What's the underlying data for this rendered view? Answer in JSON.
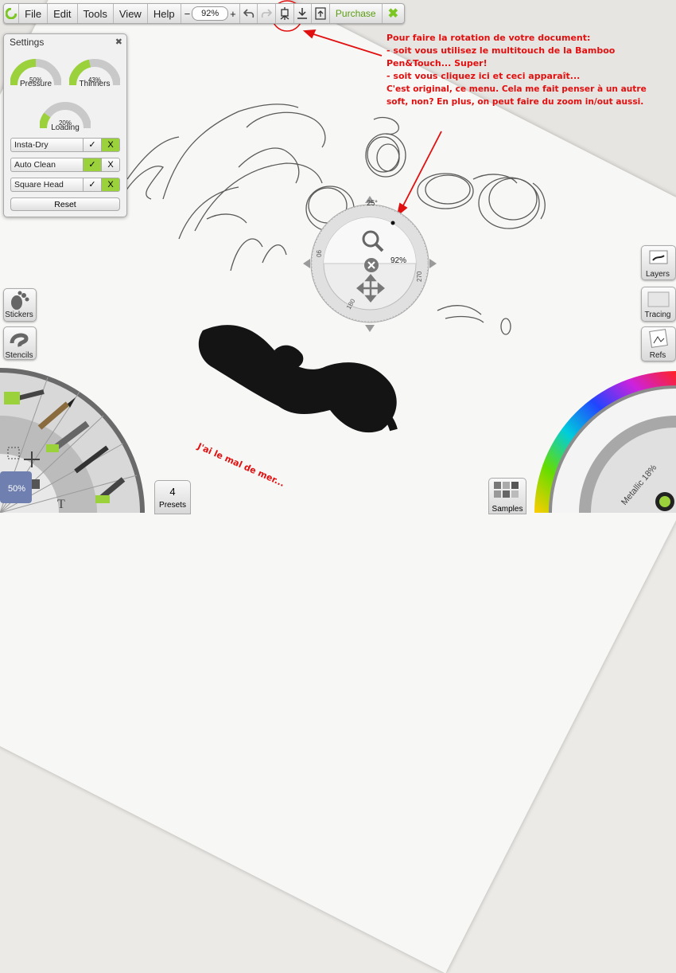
{
  "toolbar": {
    "menus": [
      "File",
      "Edit",
      "Tools",
      "View",
      "Help"
    ],
    "zoom_minus": "−",
    "zoom_value": "92%",
    "zoom_plus": "+",
    "purchase": "Purchase"
  },
  "settings": {
    "title": "Settings",
    "gauges": [
      {
        "label": "Pressure",
        "value": "50%",
        "level": 0.5
      },
      {
        "label": "Thinners",
        "value": "43%",
        "level": 0.43
      },
      {
        "label": "Loading",
        "value": "20%",
        "level": 0.2
      }
    ],
    "options": [
      {
        "label": "Insta-Dry",
        "check": "✓",
        "x": "X",
        "selected": "x"
      },
      {
        "label": "Auto Clean",
        "check": "✓",
        "x": "X",
        "selected": "check"
      },
      {
        "label": "Square Head",
        "check": "✓",
        "x": "X",
        "selected": "x"
      }
    ],
    "reset": "Reset"
  },
  "rotation_dial": {
    "angle_top": "25°",
    "zoom": "92%",
    "ticks": [
      "90",
      "270",
      "180"
    ]
  },
  "left_tools": {
    "stickers": "Stickers",
    "stencils": "Stencils",
    "brush_size": "50%"
  },
  "presets": {
    "count": "4",
    "label": "Presets"
  },
  "samples": {
    "label": "Samples"
  },
  "right_tools": {
    "layers": "Layers",
    "tracing": "Tracing",
    "refs": "Refs"
  },
  "color_wheel": {
    "metallic": "Metallic 18%"
  },
  "annotations": {
    "main": [
      "Pour faire la rotation de votre document:",
      "- soit vous utilisez le multitouch de la Bamboo",
      "Pen&Touch... Super!",
      "- soit vous cliquez ici et ceci apparaît...",
      "C'est original, ce menu. Cela me fait penser à un autre",
      "soft, non? En plus, on peut faire du zoom in/out aussi."
    ],
    "bottom": [
      "J'ai le mal de mer..."
    ]
  },
  "colors": {
    "accent": "#9bd23c",
    "annotation": "#e11010",
    "purchase": "#5a9c10"
  }
}
